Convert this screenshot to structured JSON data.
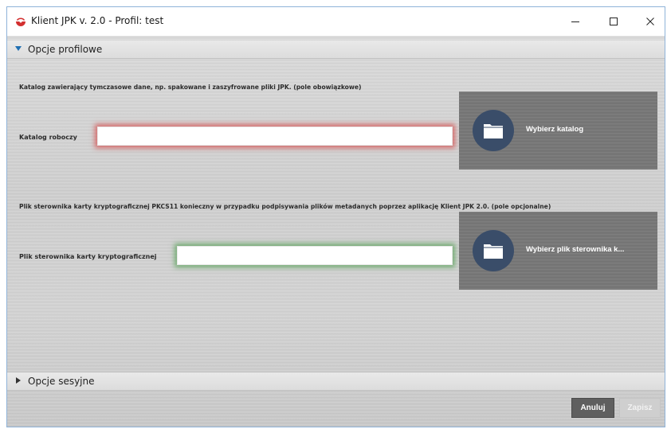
{
  "window": {
    "title": "Klient JPK v. 2.0 - Profil: test",
    "controls": {
      "minimize": "—",
      "maximize": "☐",
      "close": "✕"
    }
  },
  "sections": {
    "profile": {
      "label": "Opcje profilowe",
      "expanded": true
    },
    "session": {
      "label": "Opcje sesyjne",
      "expanded": false
    }
  },
  "profile": {
    "work_dir": {
      "hint": "Katalog zawierający tymczasowe dane, np. spakowane i zaszyfrowane pliki JPK. (pole obowiązkowe)",
      "label": "Katalog roboczy",
      "value": "",
      "button_label": "Wybierz katalog",
      "status": "error",
      "status_color": "#d64848"
    },
    "driver_file": {
      "hint": "Plik sterownika karty kryptograficznej PKCS11 konieczny w przypadku podpisywania plików metadanych poprzez aplikację Klient JPK 2.0. (pole opcjonalne)",
      "label": "Plik sterownika karty kryptograficznej",
      "value": "",
      "button_label": "Wybierz plik sterownika k...",
      "status": "ok",
      "status_color": "#54a054"
    }
  },
  "footer": {
    "cancel_label": "Anuluj",
    "save_label": "Zapisz",
    "save_enabled": false
  },
  "icons": {
    "app": "app-logo-icon",
    "folder": "folder-icon",
    "expanded": "triangle-down-icon",
    "collapsed": "triangle-right-icon"
  },
  "colors": {
    "accent": "#1f6fb2",
    "picker_bg": "#777777",
    "icon_circle": "#3a4d69"
  }
}
